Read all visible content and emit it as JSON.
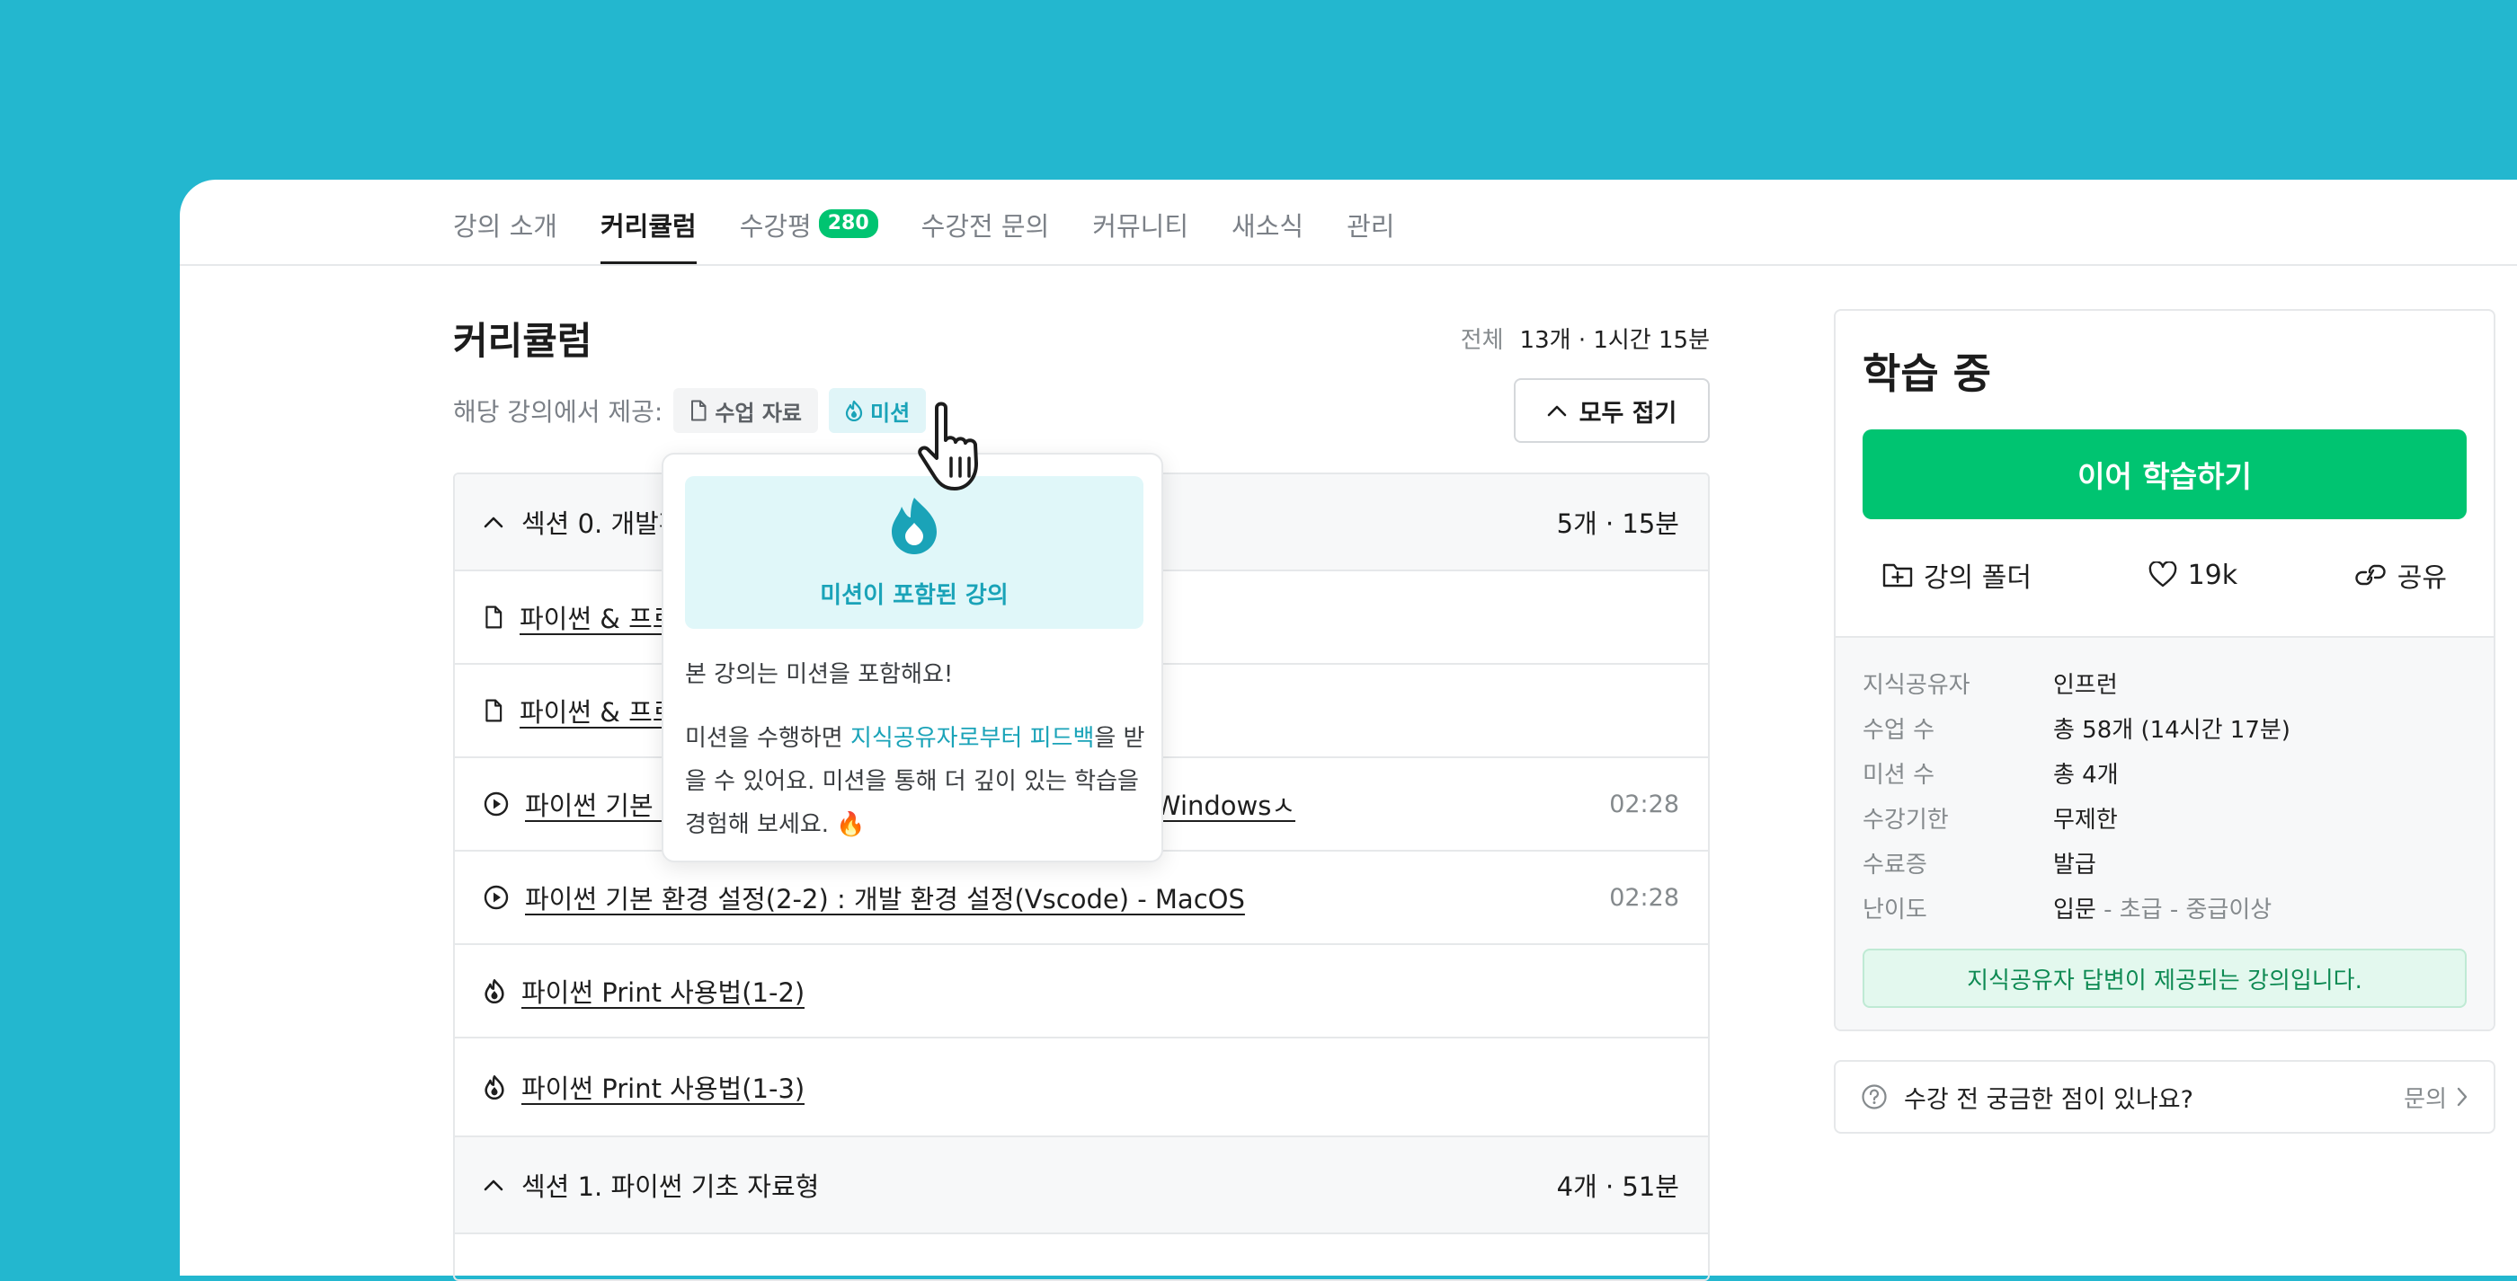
{
  "tabs": [
    {
      "label": "강의 소개"
    },
    {
      "label": "커리큘럼"
    },
    {
      "label": "수강평",
      "badge": "280"
    },
    {
      "label": "수강전 문의"
    },
    {
      "label": "커뮤니티"
    },
    {
      "label": "새소식"
    },
    {
      "label": "관리"
    }
  ],
  "curriculum": {
    "title": "커리큘럼",
    "total_label": "전체",
    "total_value": "13개 · 1시간 15분",
    "provide_label": "해당 강의에서 제공:",
    "chip_materials": "수업 자료",
    "chip_mission": "미션",
    "collapse_all": "모두 접기",
    "section0": {
      "title": "섹션 0. 개발환경 설정",
      "meta": "5개 · 15분"
    },
    "lessons": [
      {
        "title": "파이썬 & 프로그래밍에 대해 알아보고 설치할 수 있어요.",
        "time": ""
      },
      {
        "title": "파이썬 & 프로그래밍에 대해 알아보고 설치할 수 있어요.ㅅ",
        "time": ""
      },
      {
        "title": "파이썬 기본 환경 설정(2-1) : 개발 환경 설정(Vscode) - Windowsㅅ",
        "time": "02:28"
      },
      {
        "title": "파이썬 기본 환경 설정(2-2) : 개발 환경 설정(Vscode) - MacOS",
        "time": "02:28"
      },
      {
        "title": "파이썬 Print 사용법(1-2)",
        "time": ""
      },
      {
        "title": "파이썬 Print 사용법(1-3)",
        "time": ""
      }
    ],
    "section1": {
      "title": "섹션 1. 파이썬 기초 자료형",
      "meta": "4개 · 51분"
    }
  },
  "popover": {
    "hero_label": "미션이 포함된 강의",
    "text1": "본 강의는 미션을 포함해요!",
    "text2_pre": "미션을 수행하면 ",
    "text2_highlight": "지식공유자로부터 피드백",
    "text2_post": "을 받을 수 있어요. 미션을 통해 더 깊이 있는 학습을 경험해 보세요. 🔥"
  },
  "sidebar": {
    "title": "학습 중",
    "continue_button": "이어 학습하기",
    "folder_label": "강의 폴더",
    "like_count": "19k",
    "share_label": "공유",
    "info": [
      {
        "key": "지식공유자",
        "value": "인프런"
      },
      {
        "key": "수업 수",
        "value": "총 58개 (14시간 17분)"
      },
      {
        "key": "미션 수",
        "value": "총 4개"
      },
      {
        "key": "수강기한",
        "value": "무제한"
      },
      {
        "key": "수료증",
        "value": "발급"
      }
    ],
    "level_key": "난이도",
    "level_current": "입문",
    "level_rest": " - 초급 - 중급이상",
    "notice": "지식공유자 답변이 제공되는 강의입니다."
  },
  "question": {
    "text": "수강 전 궁금한 점이 있나요?",
    "link": "문의"
  },
  "colors": {
    "background": "#23b7cf",
    "brand_green": "#00c471",
    "mission_teal": "#1aa3b8"
  },
  "icons": [
    "file-icon",
    "mission-flame-icon",
    "chevron-up-icon",
    "play-icon",
    "folder-plus-icon",
    "heart-icon",
    "link-icon",
    "help-circle-icon",
    "chevron-right-icon",
    "hand-cursor-icon"
  ]
}
